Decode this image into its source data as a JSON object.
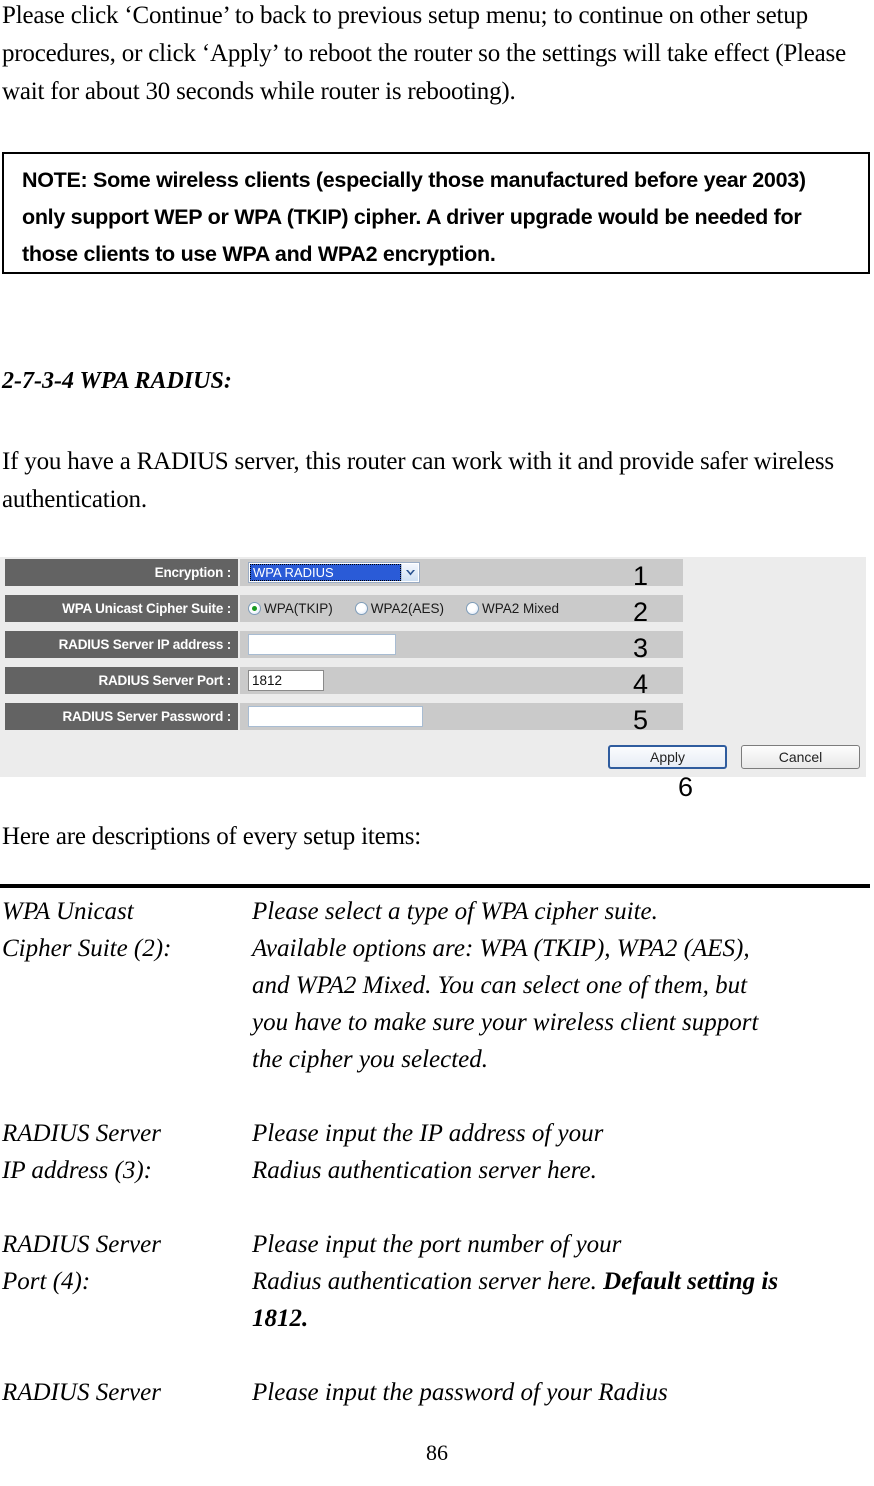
{
  "document": {
    "page_number": "86",
    "intro_paragraph": "Please click ‘Continue’ to back to previous setup menu; to continue on other setup procedures, or click ‘Apply’ to reboot the router so the settings will take effect (Please wait for about 30 seconds while router is rebooting).",
    "note_box": "NOTE: Some wireless clients (especially those manufactured before year 2003) only support WEP or WPA (TKIP) cipher. A driver upgrade would be needed for those clients to use WPA and WPA2 encryption.",
    "section_heading": "2-7-3-4 WPA RADIUS:",
    "lead_paragraph": "If you have a RADIUS server, this router can work with it and provide safer wireless authentication.",
    "descriptions_intro": "Here are descriptions of every setup items:"
  },
  "panel": {
    "rows": [
      {
        "label": "Encryption :",
        "annotation": "1"
      },
      {
        "label": "WPA Unicast Cipher Suite :",
        "annotation": "2"
      },
      {
        "label": "RADIUS Server IP address :",
        "annotation": "3"
      },
      {
        "label": "RADIUS Server Port :",
        "annotation": "4"
      },
      {
        "label": "RADIUS Server Password :",
        "annotation": "5"
      }
    ],
    "encryption_select": {
      "selected": "WPA RADIUS",
      "icon": "chevron-down-icon"
    },
    "cipher_radios": [
      {
        "label": "WPA(TKIP)",
        "selected": true
      },
      {
        "label": "WPA2(AES)",
        "selected": false
      },
      {
        "label": "WPA2 Mixed",
        "selected": false
      }
    ],
    "radius_ip": {
      "value": "",
      "placeholder": ""
    },
    "radius_port": {
      "value": "1812",
      "placeholder": ""
    },
    "radius_password": {
      "value": "",
      "placeholder": ""
    },
    "buttons": {
      "apply": "Apply",
      "cancel": "Cancel",
      "annotation": "6"
    },
    "colors": {
      "label_cell": "#636363",
      "value_cell": "#cacaca",
      "panel_bg": "#ececec",
      "select_highlight": "#2a5bd7",
      "radio_dot": "#1a9a22",
      "primary_button_border": "#2f5c9e"
    }
  },
  "definitions": [
    {
      "term_line1": "WPA Unicast",
      "term_line2": "Cipher Suite (2):",
      "desc_line1": "Please select a type of WPA cipher suite.",
      "desc_line2": "Available options are: WPA (TKIP), WPA2 (AES),",
      "desc_line3": "and WPA2 Mixed. You can select one of them, but",
      "desc_line4": "you have to make sure your wireless client support",
      "desc_line5": "the cipher you selected."
    },
    {
      "term_line1": "RADIUS Server",
      "term_line2": "IP address (3):",
      "desc_line1": "Please input the IP address of your",
      "desc_line2": "Radius authentication server here."
    },
    {
      "term_line1": "RADIUS Server",
      "term_line2": "Port (4):",
      "desc_line1": "Please input the port number of your",
      "desc_line2_plain": "Radius authentication server here. ",
      "desc_line2_bold": "Default setting is",
      "desc_line3_bold": "1812."
    },
    {
      "term_line1": "RADIUS Server",
      "desc_line1": "Please input the password of your Radius"
    }
  ]
}
